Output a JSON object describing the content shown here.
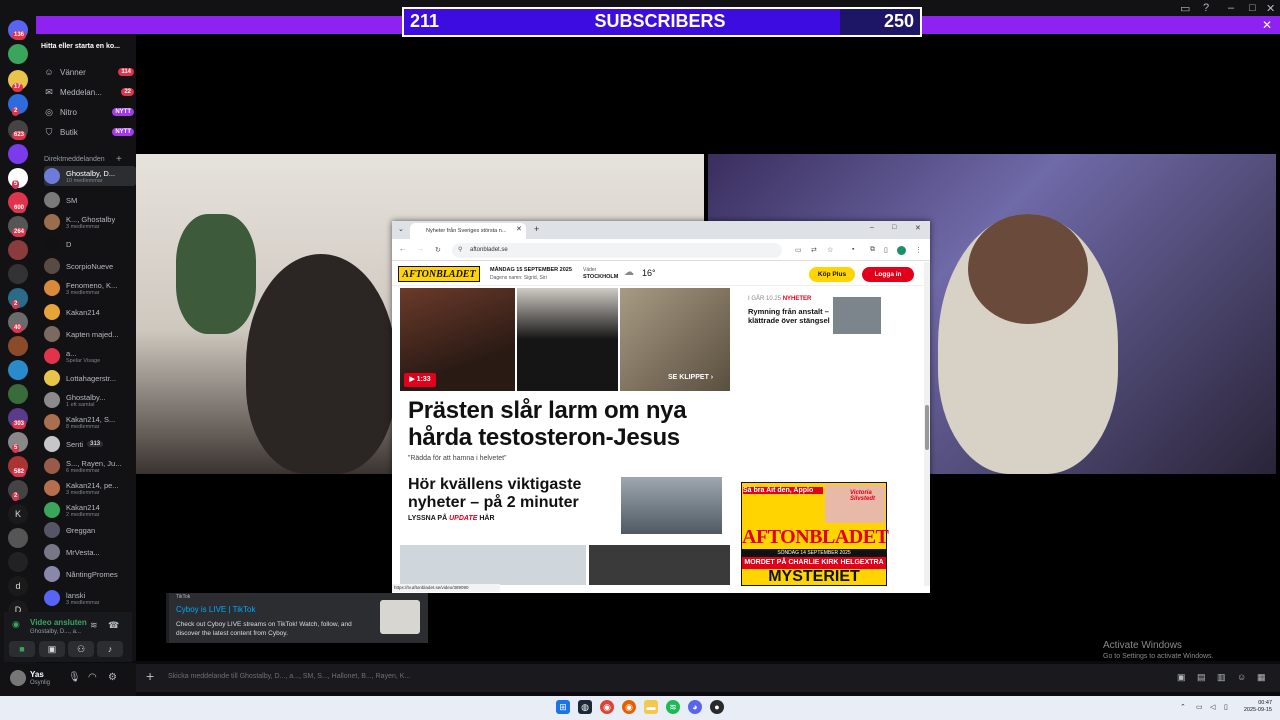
{
  "subscribers": {
    "current": "211",
    "label": "SUBSCRIBERS",
    "goal": "250",
    "progress_fraction": 0.844
  },
  "discord": {
    "search_placeholder": "Hitta eller starta en ko...",
    "nav": [
      {
        "label": "Vänner",
        "badge": "114",
        "icon": "friends-icon"
      },
      {
        "label": "Meddelan...",
        "badge": "22",
        "icon": "mail-icon"
      },
      {
        "label": "Nitro",
        "badge": "NYTT",
        "icon": "nitro-icon"
      },
      {
        "label": "Butik",
        "badge": "NYTT",
        "icon": "shop-icon"
      }
    ],
    "dm_header": "Direktmeddelanden",
    "dms": [
      {
        "name": "Ghostalby, D...",
        "sub": "10 medlemmar",
        "color": "#6e7bd8"
      },
      {
        "name": "SM",
        "sub": "",
        "color": "#7a7a7a"
      },
      {
        "name": "K..., Ghostalby",
        "sub": "3 medlemmar",
        "color": "#9a6d4e"
      },
      {
        "name": "D",
        "sub": "",
        "color": "#111111"
      },
      {
        "name": "ScorpioNueve",
        "sub": "",
        "color": "#5a4a44"
      },
      {
        "name": "Fenomeno, K...",
        "sub": "3 medlemmar",
        "color": "#d88a3a"
      },
      {
        "name": "Kakan214",
        "sub": "",
        "color": "#e6a43a"
      },
      {
        "name": "Kapten majed...",
        "sub": "",
        "color": "#7b6a60"
      },
      {
        "name": "a...",
        "sub": "Spelar Visage",
        "color": "#e0334c"
      },
      {
        "name": "Lottahagerstr...",
        "sub": "",
        "color": "#e8c44a"
      },
      {
        "name": "Ghostalby...",
        "sub": "1 ett samtal",
        "color": "#8b8b8b"
      },
      {
        "name": "Kakan214, S...",
        "sub": "8 medlemmar",
        "color": "#a87050"
      },
      {
        "name": "Senti",
        "sub": "",
        "color": "#c6c6c6"
      },
      {
        "name": "S..., Rayen, Ju...",
        "sub": "6 medlemmar",
        "color": "#9a5a4a"
      },
      {
        "name": "Kakan214, pe...",
        "sub": "3 medlemmar",
        "color": "#b56f4f"
      },
      {
        "name": "Kakan214",
        "sub": "2 medlemmar",
        "color": "#3ba55c"
      },
      {
        "name": "Θreggan",
        "sub": "",
        "color": "#555566"
      },
      {
        "name": "MrVesta...",
        "sub": "",
        "color": "#777788"
      },
      {
        "name": "NåntingPromes",
        "sub": "",
        "color": "#8888aa"
      },
      {
        "name": "lanski",
        "sub": "3 medlemmar",
        "color": "#5865f2"
      }
    ],
    "senti_badge": "313",
    "voice": {
      "status": "Video ansluten",
      "channel": "Ghostalby, D..., a..."
    },
    "user": {
      "name": "Yas",
      "status": "Osynlig"
    },
    "embed": {
      "source": "TikTok",
      "title": "Cyboy is LIVE | TikTok",
      "description": "Check out Cyboy LIVE streams on TikTok! Watch, follow, and discover the latest content from Cyboy."
    },
    "chat_placeholder": "Skicka meddelande till Ghostalby, D..., a..., SM, S..., Hallonet, B..., Rayen, K...",
    "server_badges": [
      "136",
      "17",
      "2",
      "623",
      "5",
      "600",
      "264",
      "2",
      "40",
      "303",
      "5",
      "582",
      "2"
    ],
    "server_letters": [
      "K",
      "d",
      "D"
    ]
  },
  "browser": {
    "tab_title": "Nyheter från Sveriges största n...",
    "url": "aftonbladet.se",
    "status_url": "https://tv.aftonbladet.se/video/389090",
    "site": {
      "logo": "AFTONBLADET",
      "date": "MÅNDAG 15 SEPTEMBER 2025",
      "namedays": "Dagens namn: Sigrid, Siri",
      "weather_label": "Väder",
      "weather_city": "STOCKHOLM",
      "temp": "16°",
      "buy": "Köp Plus",
      "login": "Logga in"
    },
    "video_duration": "1:33",
    "clip_label": "SE KLIPPET",
    "headline": "Prästen slår larm om nya hårda testosteron-Jesus",
    "quote": "”Rädda för att hamna i helvetet”",
    "second_headline": "Hör kvällens viktigaste nyheter – på 2 minuter",
    "second_sub_prefix": "LYSSNA PÅ",
    "second_sub_em": "UPDATE",
    "second_sub_suffix": "HÄR",
    "side_time": "I GÅR 10.25",
    "side_tag": "NYHETER",
    "side_text": "Rymning från anstalt – klättrade över stängsel",
    "ad": {
      "top": "Så bra Ait den, Applo",
      "name": "Victoria Silvstedt",
      "title": "AFTONBLADET",
      "date": "SÖNDAG 14 SEPTEMBER 2025",
      "headline": "MORDET PÅ CHARLIE KIRK",
      "extra": "HELGEXTRA",
      "mystery": "MYSTERIET"
    }
  },
  "windows": {
    "activate_title": "Activate Windows",
    "activate_sub": "Go to Settings to activate Windows.",
    "time": "00:47",
    "date": "2025-09-15"
  }
}
